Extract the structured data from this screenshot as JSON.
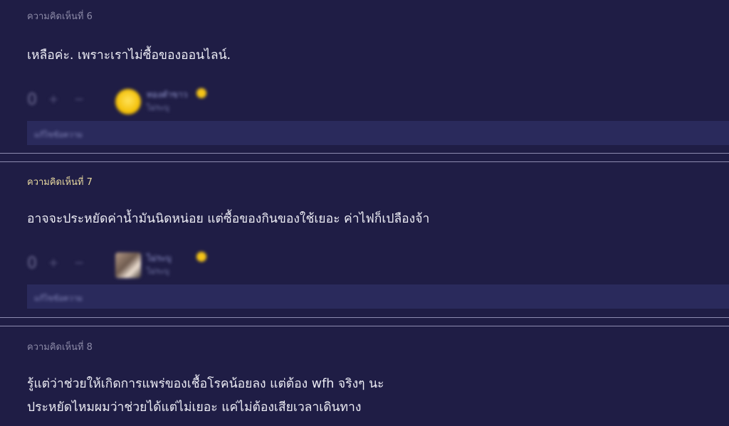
{
  "comments": [
    {
      "number_label": "ความคิดเห็นที่ 6",
      "lines": [
        "เหลือค่ะ.  เพราะเราไม่ซื้อของออนไลน์."
      ],
      "votes": "0",
      "plus_icon": "+",
      "minus_icon": "−",
      "user": "ทองคำขาว",
      "time": "ไม่ระบุ",
      "edited": "แก้ไขข้อความ"
    },
    {
      "number_label": "ความคิดเห็นที่ 7",
      "lines": [
        "อาจจะประหยัดค่าน้ำมันนิดหน่อย แต่ซื้อของกินของใช้เยอะ  ค่าไฟก็เปลืองจ้า"
      ],
      "votes": "0",
      "plus_icon": "+",
      "minus_icon": "−",
      "user": "ไม่ระบุ",
      "time": "ไม่ระบุ",
      "edited": "แก้ไขข้อความ"
    },
    {
      "number_label": "ความคิดเห็นที่ 8",
      "lines": [
        "รู้แต่ว่าช่วยให้เกิดการแพร่ของเชื้อโรคน้อยลง  แต่ต้อง wfh  จริงๆ นะ",
        "ประหยัดไหมผมว่าช่วยได้แต่ไม่เยอะ  แค่ไม่ต้องเสียเวลาเดินทาง"
      ]
    }
  ]
}
